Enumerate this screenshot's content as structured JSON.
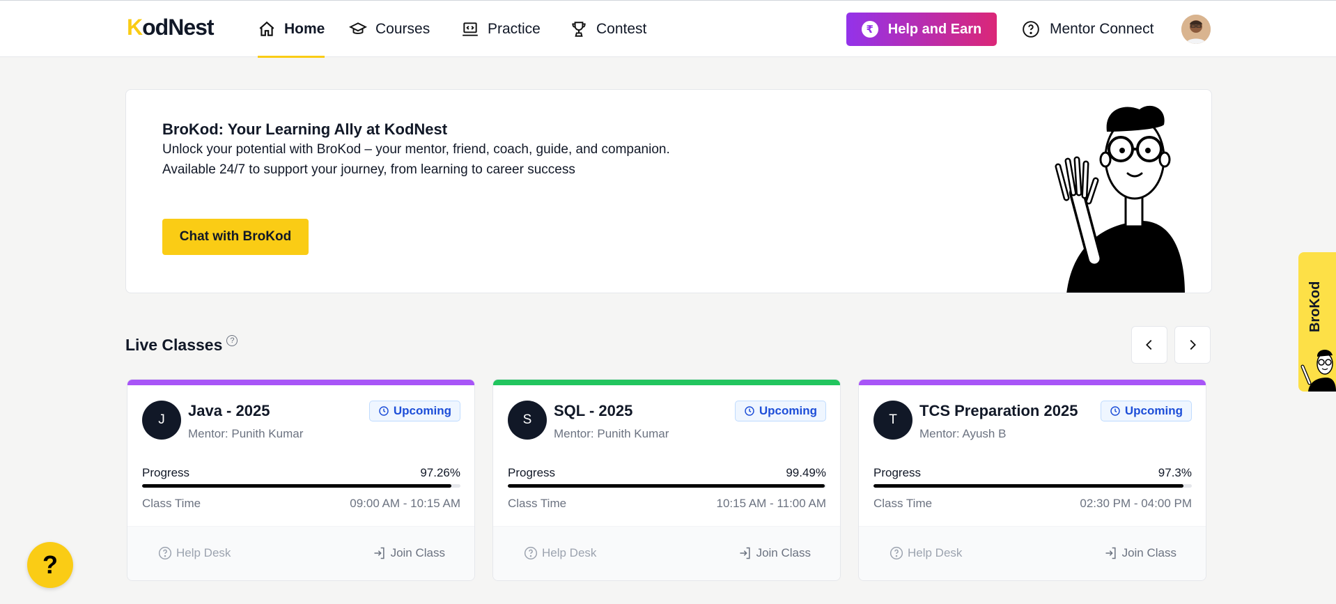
{
  "brand": {
    "logo_prefix": "K",
    "logo_rest": "odNest"
  },
  "nav": {
    "items": [
      {
        "label": "Home",
        "icon": "home-icon",
        "active": true
      },
      {
        "label": "Courses",
        "icon": "graduation-cap-icon"
      },
      {
        "label": "Practice",
        "icon": "laptop-code-icon"
      },
      {
        "label": "Contest",
        "icon": "trophy-icon"
      }
    ],
    "help_earn": "Help and Earn",
    "help_earn_icon": "rupee-icon",
    "mentor_connect": "Mentor Connect"
  },
  "hero": {
    "title": "BroKod: Your Learning Ally at KodNest",
    "line1": "Unlock your potential with BroKod – your mentor, friend, coach, guide, and companion.",
    "line2": "Available 24/7 to support your journey, from learning to career success",
    "cta": "Chat with BroKod"
  },
  "live_classes": {
    "title": "Live Classes",
    "help_mark": "?",
    "cards": [
      {
        "initial": "J",
        "title": "Java - 2025",
        "mentor": "Mentor: Punith Kumar",
        "status": "Upcoming",
        "progress_label": "Progress",
        "progress": "97.26%",
        "progress_value": 97.26,
        "time_label": "Class Time",
        "time": "09:00 AM - 10:15 AM",
        "help": "Help Desk",
        "join": "Join Class",
        "accent": "#a855f7"
      },
      {
        "initial": "S",
        "title": "SQL - 2025",
        "mentor": "Mentor: Punith Kumar",
        "status": "Upcoming",
        "progress_label": "Progress",
        "progress": "99.49%",
        "progress_value": 99.49,
        "time_label": "Class Time",
        "time": "10:15 AM - 11:00 AM",
        "help": "Help Desk",
        "join": "Join Class",
        "accent": "#22c55e"
      },
      {
        "initial": "T",
        "title": "TCS Preparation 2025",
        "mentor": "Mentor: Ayush B",
        "status": "Upcoming",
        "progress_label": "Progress",
        "progress": "97.3%",
        "progress_value": 97.3,
        "time_label": "Class Time",
        "time": "02:30 PM - 04:00 PM",
        "help": "Help Desk",
        "join": "Join Class",
        "accent": "#a855f7"
      }
    ]
  },
  "side_tab": {
    "label": "BroKod"
  },
  "help_fab": {
    "label": "?"
  }
}
